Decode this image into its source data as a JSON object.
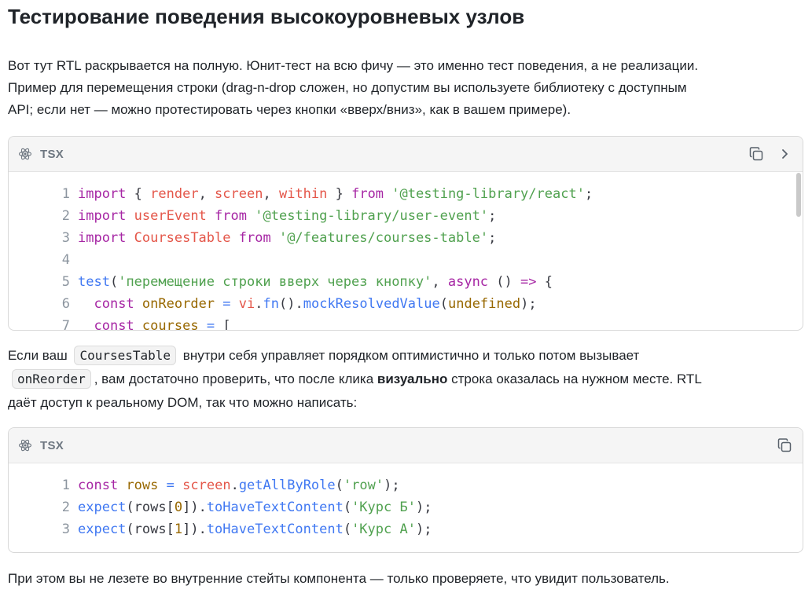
{
  "heading": "Тестирование поведения высокоуровневых узлов",
  "intro": {
    "line1": "Вот тут RTL раскрывается на полную. Юнит-тест на всю фичу — это именно тест поведения, а не реализации.",
    "line2": "Пример для перемещения строки (drag-n-drop сложен, но допустим вы используете библиотеку с доступным",
    "line3": "API; если нет — можно протестировать через кнопки «вверх/вниз», как в вашем примере)."
  },
  "code_block_1": {
    "language": "TSX",
    "language_icon": "react-icon",
    "copy_icon": "copy-icon",
    "expand_icon": "chevron-right-icon",
    "lines": [
      {
        "n": "1",
        "tokens": [
          [
            "kw",
            "import"
          ],
          [
            "pn",
            " { "
          ],
          [
            "var",
            "render"
          ],
          [
            "pn",
            ", "
          ],
          [
            "var",
            "screen"
          ],
          [
            "pn",
            ", "
          ],
          [
            "var",
            "within"
          ],
          [
            "pn",
            " } "
          ],
          [
            "kw",
            "from"
          ],
          [
            "pn",
            " "
          ],
          [
            "str",
            "'@testing-library/react'"
          ],
          [
            "pn",
            ";"
          ]
        ]
      },
      {
        "n": "2",
        "tokens": [
          [
            "kw",
            "import"
          ],
          [
            "pn",
            " "
          ],
          [
            "var",
            "userEvent"
          ],
          [
            "pn",
            " "
          ],
          [
            "kw",
            "from"
          ],
          [
            "pn",
            " "
          ],
          [
            "str",
            "'@testing-library/user-event'"
          ],
          [
            "pn",
            ";"
          ]
        ]
      },
      {
        "n": "3",
        "tokens": [
          [
            "kw",
            "import"
          ],
          [
            "pn",
            " "
          ],
          [
            "var",
            "CoursesTable"
          ],
          [
            "pn",
            " "
          ],
          [
            "kw",
            "from"
          ],
          [
            "pn",
            " "
          ],
          [
            "str",
            "'@/features/courses-table'"
          ],
          [
            "pn",
            ";"
          ]
        ]
      },
      {
        "n": "4",
        "tokens": []
      },
      {
        "n": "5",
        "tokens": [
          [
            "fn",
            "test"
          ],
          [
            "pn",
            "("
          ],
          [
            "str",
            "'перемещение строки вверх через кнопку'"
          ],
          [
            "pn",
            ", "
          ],
          [
            "kw",
            "async"
          ],
          [
            "pn",
            " () "
          ],
          [
            "kw",
            "=>"
          ],
          [
            "pn",
            " {"
          ]
        ]
      },
      {
        "n": "6",
        "tokens": [
          [
            "pn",
            "  "
          ],
          [
            "kw",
            "const"
          ],
          [
            "pn",
            " "
          ],
          [
            "nm",
            "onReorder"
          ],
          [
            "pn",
            " "
          ],
          [
            "fn",
            "="
          ],
          [
            "pn",
            " "
          ],
          [
            "var",
            "vi"
          ],
          [
            "pn",
            "."
          ],
          [
            "fn",
            "fn"
          ],
          [
            "pn",
            "()."
          ],
          [
            "fn",
            "mockResolvedValue"
          ],
          [
            "pn",
            "("
          ],
          [
            "nm",
            "undefined"
          ],
          [
            "pn",
            ");"
          ]
        ]
      },
      {
        "n": "7",
        "tokens": [
          [
            "pn",
            "  "
          ],
          [
            "kw",
            "const"
          ],
          [
            "pn",
            " "
          ],
          [
            "nm",
            "courses"
          ],
          [
            "pn",
            " "
          ],
          [
            "fn",
            "="
          ],
          [
            "pn",
            " ["
          ]
        ]
      }
    ]
  },
  "middle": {
    "part1": "Если ваш",
    "code1": "CoursesTable",
    "part2": "внутри себя управляет порядком оптимистично и только потом вызывает",
    "code2": "onReorder",
    "part3": ", вам достаточно проверить, что после клика",
    "bold": "визуально",
    "part4": "строка оказалась на нужном месте. RTL",
    "line3": "даёт доступ к реальному DOM, так что можно написать:"
  },
  "code_block_2": {
    "language": "TSX",
    "language_icon": "react-icon",
    "copy_icon": "copy-icon",
    "lines": [
      {
        "n": "1",
        "tokens": [
          [
            "kw",
            "const"
          ],
          [
            "pn",
            " "
          ],
          [
            "nm",
            "rows"
          ],
          [
            "pn",
            " "
          ],
          [
            "fn",
            "="
          ],
          [
            "pn",
            " "
          ],
          [
            "var",
            "screen"
          ],
          [
            "pn",
            "."
          ],
          [
            "fn",
            "getAllByRole"
          ],
          [
            "pn",
            "("
          ],
          [
            "str",
            "'row'"
          ],
          [
            "pn",
            ");"
          ]
        ]
      },
      {
        "n": "2",
        "tokens": [
          [
            "fn",
            "expect"
          ],
          [
            "pn",
            "(rows["
          ],
          [
            "nm",
            "0"
          ],
          [
            "pn",
            "])."
          ],
          [
            "fn",
            "toHaveTextContent"
          ],
          [
            "pn",
            "("
          ],
          [
            "str",
            "'Курс Б'"
          ],
          [
            "pn",
            ");"
          ]
        ]
      },
      {
        "n": "3",
        "tokens": [
          [
            "fn",
            "expect"
          ],
          [
            "pn",
            "(rows["
          ],
          [
            "nm",
            "1"
          ],
          [
            "pn",
            "])."
          ],
          [
            "fn",
            "toHaveTextContent"
          ],
          [
            "pn",
            "("
          ],
          [
            "str",
            "'Курс А'"
          ],
          [
            "pn",
            ");"
          ]
        ]
      }
    ]
  },
  "outro": "При этом вы не лезете во внутренние стейты компонента — только проверяете, что увидит пользователь."
}
